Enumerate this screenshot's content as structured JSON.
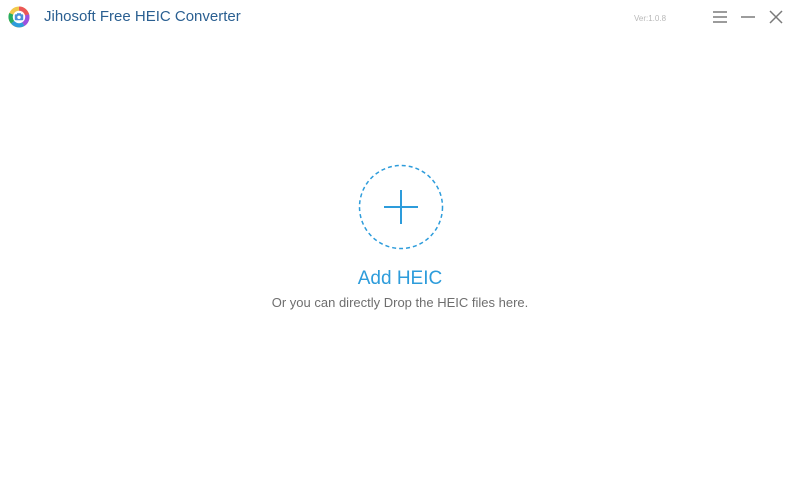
{
  "titlebar": {
    "title": "Jihosoft Free HEIC Converter",
    "version": "Ver:1.0.8",
    "icons": {
      "logo": "camera-shutter-logo",
      "menu": "hamburger-menu-icon",
      "minimize": "minimize-icon",
      "close": "close-icon"
    }
  },
  "main": {
    "add_label": "Add HEIC",
    "drop_hint": "Or you can directly Drop the HEIC files here.",
    "add_icon": "plus-icon"
  },
  "colors": {
    "title": "#2a5f91",
    "accent": "#2d9cdb",
    "hint": "#6e6e6e",
    "version": "#b8b8b8",
    "controls": "#7a7a7a"
  }
}
